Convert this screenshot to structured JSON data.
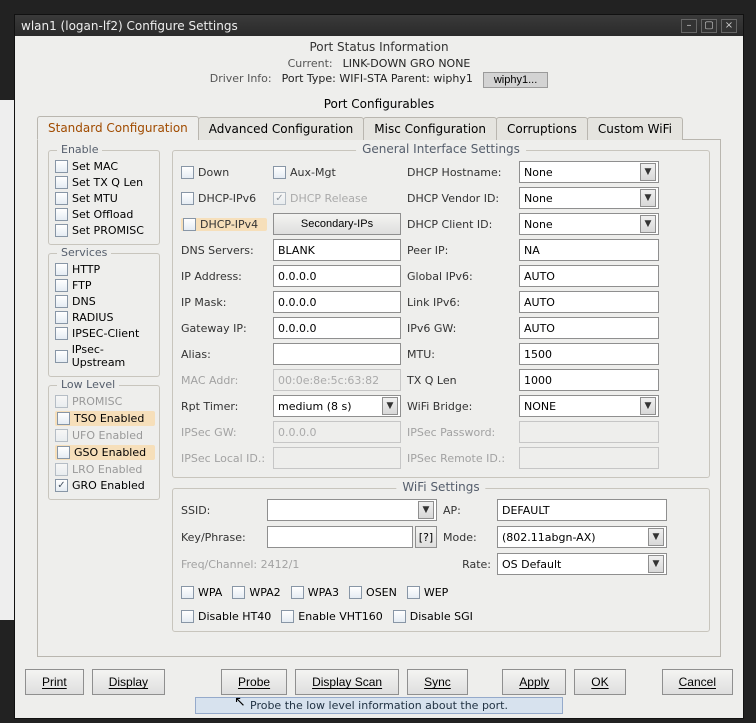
{
  "window": {
    "title": "wlan1  (logan-lf2) Configure Settings"
  },
  "psi": {
    "header": "Port Status Information",
    "current_label": "Current:",
    "current_value": "LINK-DOWN GRO  NONE",
    "driver_label": "Driver Info:",
    "driver_value": "Port Type: WIFI-STA   Parent: wiphy1",
    "wiphy_btn": "wiphy1..."
  },
  "pc_title": "Port Configurables",
  "tabs": [
    "Standard Configuration",
    "Advanced Configuration",
    "Misc Configuration",
    "Corruptions",
    "Custom WiFi"
  ],
  "enable": {
    "title": "Enable",
    "items": [
      "Set MAC",
      "Set TX Q Len",
      "Set MTU",
      "Set Offload",
      "Set PROMISC"
    ]
  },
  "services": {
    "title": "Services",
    "items": [
      "HTTP",
      "FTP",
      "DNS",
      "RADIUS",
      "IPSEC-Client",
      "IPsec-Upstream"
    ]
  },
  "lowlevel": {
    "title": "Low Level",
    "items": [
      {
        "label": "PROMISC",
        "checked": false,
        "disabled": true,
        "hl": false
      },
      {
        "label": "TSO Enabled",
        "checked": false,
        "disabled": false,
        "hl": true
      },
      {
        "label": "UFO Enabled",
        "checked": false,
        "disabled": true,
        "hl": false
      },
      {
        "label": "GSO Enabled",
        "checked": false,
        "disabled": false,
        "hl": true
      },
      {
        "label": "LRO Enabled",
        "checked": false,
        "disabled": true,
        "hl": false
      },
      {
        "label": "GRO Enabled",
        "checked": true,
        "disabled": false,
        "hl": false
      }
    ]
  },
  "general": {
    "title": "General Interface Settings",
    "down": "Down",
    "auxmgt": "Aux-Mgt",
    "dhcp_host_lbl": "DHCP Hostname:",
    "dhcp_host_val": "None",
    "dhcp6": "DHCP-IPv6",
    "dhcp_rel": "DHCP Release",
    "dhcp_vendor_lbl": "DHCP Vendor ID:",
    "dhcp_vendor_val": "None",
    "dhcp4": "DHCP-IPv4",
    "secip": "Secondary-IPs",
    "dhcp_client_lbl": "DHCP Client ID:",
    "dhcp_client_val": "None",
    "dns_lbl": "DNS Servers:",
    "dns_val": "BLANK",
    "peer_lbl": "Peer IP:",
    "peer_val": "NA",
    "ip_lbl": "IP Address:",
    "ip_val": "0.0.0.0",
    "g6_lbl": "Global IPv6:",
    "g6_val": "AUTO",
    "mask_lbl": "IP Mask:",
    "mask_val": "0.0.0.0",
    "l6_lbl": "Link IPv6:",
    "l6_val": "AUTO",
    "gw_lbl": "Gateway IP:",
    "gw_val": "0.0.0.0",
    "v6gw_lbl": "IPv6 GW:",
    "v6gw_val": "AUTO",
    "alias_lbl": "Alias:",
    "alias_val": "",
    "mtu_lbl": "MTU:",
    "mtu_val": "1500",
    "mac_lbl": "MAC Addr:",
    "mac_val": "00:0e:8e:5c:63:82",
    "txq_lbl": "TX Q Len",
    "txq_val": "1000",
    "rpt_lbl": "Rpt Timer:",
    "rpt_val": "medium  (8 s)",
    "wbr_lbl": "WiFi Bridge:",
    "wbr_val": "NONE",
    "ipsgw_lbl": "IPSec GW:",
    "ipsgw_val": "0.0.0.0",
    "ipspw_lbl": "IPSec Password:",
    "ipspw_val": "",
    "iplid_lbl": "IPSec Local ID.:",
    "iplid_val": "",
    "iprid_lbl": "IPSec Remote ID.:",
    "iprid_val": ""
  },
  "wifi": {
    "title": "WiFi Settings",
    "ssid_lbl": "SSID:",
    "ssid_val": "",
    "ap_lbl": "AP:",
    "ap_val": "DEFAULT",
    "key_lbl": "Key/Phrase:",
    "key_val": "",
    "q": "[?]",
    "mode_lbl": "Mode:",
    "mode_val": "(802.11abgn-AX)",
    "freq_lbl": "Freq/Channel: 2412/1",
    "rate_lbl": "Rate:",
    "rate_val": "OS Default",
    "checks1": [
      "WPA",
      "WPA2",
      "WPA3",
      "OSEN",
      "WEP"
    ],
    "checks2": [
      "Disable HT40",
      "Enable VHT160",
      "Disable SGI"
    ]
  },
  "footer": {
    "print": "Print",
    "display": "Display",
    "probe": "Probe",
    "scan": "Display Scan",
    "sync": "Sync",
    "apply": "Apply",
    "ok": "OK",
    "cancel": "Cancel"
  },
  "status_tip": "Probe the low level information about the port."
}
